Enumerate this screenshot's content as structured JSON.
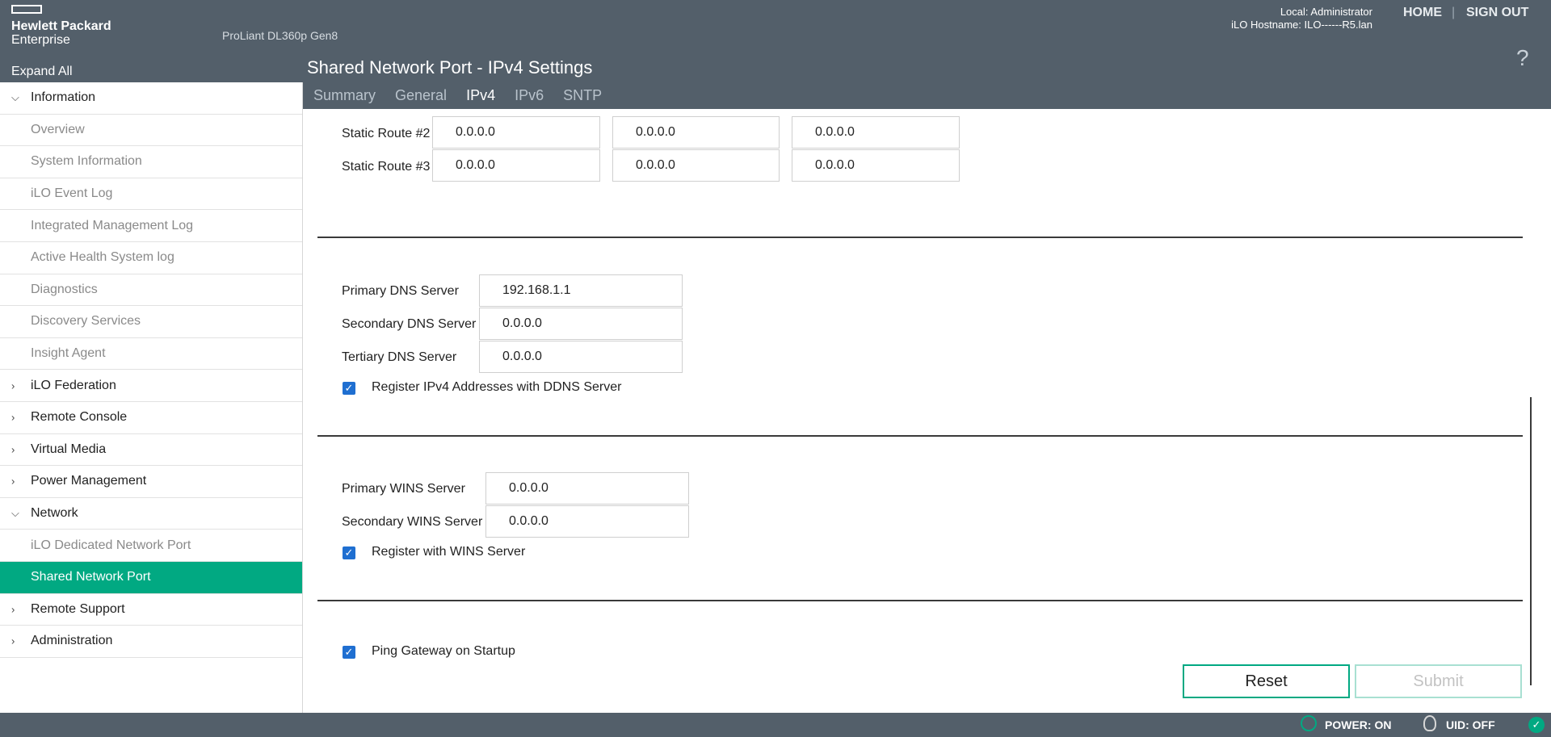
{
  "header": {
    "brand_line1": "Hewlett Packard",
    "brand_line2": "Enterprise",
    "server_model": "ProLiant DL360p Gen8",
    "user": "Local: Administrator",
    "hostname": "iLO Hostname: ILO------R5.lan",
    "home": "HOME",
    "separator": "|",
    "signout": "SIGN OUT",
    "help": "?"
  },
  "sidebar": {
    "expand_all": "Expand All",
    "items": [
      {
        "label": "Information",
        "kind": "group",
        "icon": "chevron-down-icon",
        "glyph": "⌵"
      },
      {
        "label": "Overview",
        "kind": "sub"
      },
      {
        "label": "System Information",
        "kind": "sub"
      },
      {
        "label": "iLO Event Log",
        "kind": "sub"
      },
      {
        "label": "Integrated Management Log",
        "kind": "sub"
      },
      {
        "label": "Active Health System log",
        "kind": "sub"
      },
      {
        "label": "Diagnostics",
        "kind": "sub"
      },
      {
        "label": "Discovery Services",
        "kind": "sub"
      },
      {
        "label": "Insight Agent",
        "kind": "sub"
      },
      {
        "label": "iLO Federation",
        "kind": "group",
        "icon": "chevron-right-icon",
        "glyph": "›"
      },
      {
        "label": "Remote Console",
        "kind": "group",
        "icon": "chevron-right-icon",
        "glyph": "›"
      },
      {
        "label": "Virtual Media",
        "kind": "group",
        "icon": "chevron-right-icon",
        "glyph": "›"
      },
      {
        "label": "Power Management",
        "kind": "group",
        "icon": "chevron-right-icon",
        "glyph": "›"
      },
      {
        "label": "Network",
        "kind": "group",
        "icon": "chevron-down-icon",
        "glyph": "⌵"
      },
      {
        "label": "iLO Dedicated Network Port",
        "kind": "sub"
      },
      {
        "label": "Shared Network Port",
        "kind": "sub",
        "active": true
      },
      {
        "label": "Remote Support",
        "kind": "group",
        "icon": "chevron-right-icon",
        "glyph": "›"
      },
      {
        "label": "Administration",
        "kind": "group",
        "icon": "chevron-right-icon",
        "glyph": "›"
      }
    ]
  },
  "page": {
    "title": "Shared Network Port - IPv4 Settings",
    "tabs": [
      {
        "label": "Summary",
        "active": false
      },
      {
        "label": "General",
        "active": false
      },
      {
        "label": "IPv4",
        "active": true
      },
      {
        "label": "IPv6",
        "active": false
      },
      {
        "label": "SNTP",
        "active": false
      }
    ]
  },
  "static_routes": [
    {
      "label": "Static Route #2",
      "values": [
        "0.0.0.0",
        "0.0.0.0",
        "0.0.0.0"
      ]
    },
    {
      "label": "Static Route #3",
      "values": [
        "0.0.0.0",
        "0.0.0.0",
        "0.0.0.0"
      ]
    }
  ],
  "dns": {
    "primary_label": "Primary DNS Server",
    "primary_value": "192.168.1.1",
    "secondary_label": "Secondary DNS Server",
    "secondary_value": "0.0.0.0",
    "tertiary_label": "Tertiary DNS Server",
    "tertiary_value": "0.0.0.0",
    "ddns_label": "Register IPv4 Addresses with DDNS Server",
    "ddns_checked": true
  },
  "wins": {
    "primary_label": "Primary WINS Server",
    "primary_value": "0.0.0.0",
    "secondary_label": "Secondary WINS Server",
    "secondary_value": "0.0.0.0",
    "register_label": "Register with WINS Server",
    "register_checked": true
  },
  "ping": {
    "label": "Ping Gateway on Startup",
    "checked": true
  },
  "buttons": {
    "reset": "Reset",
    "submit": "Submit"
  },
  "status": {
    "power": "POWER: ON",
    "uid": "UID: OFF"
  },
  "colors": {
    "header_bg": "#535f6a",
    "accent": "#01a982",
    "checkbox": "#1f6fd1"
  }
}
